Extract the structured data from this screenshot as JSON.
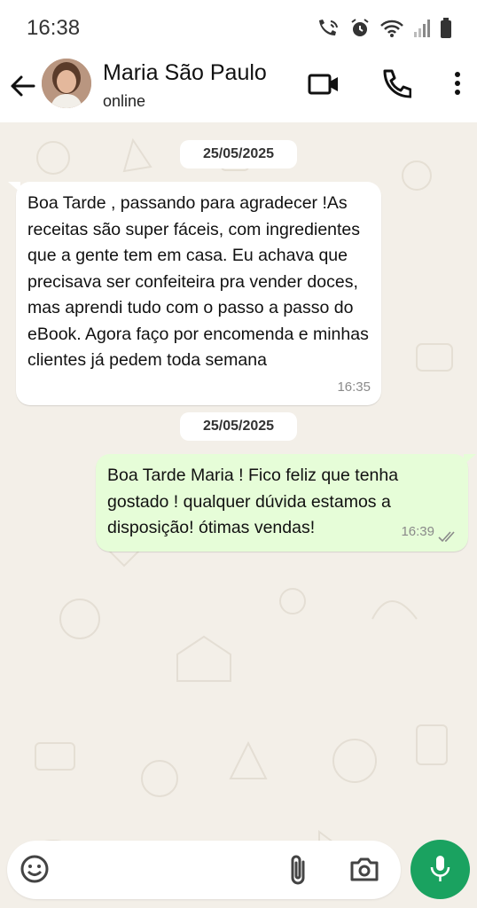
{
  "status_bar": {
    "time": "16:38"
  },
  "header": {
    "contact_name": "Maria São Paulo",
    "contact_status": "online"
  },
  "messages": [
    {
      "date": "25/05/2025",
      "direction": "incoming",
      "text": "Boa Tarde , passando para agradecer !As receitas são super fáceis, com ingredientes que a gente tem em casa. Eu achava que precisava ser confeiteira pra vender doces, mas aprendi tudo com o passo a passo do eBook. Agora faço por encomenda e minhas clientes já pedem toda semana",
      "time": "16:35"
    },
    {
      "date": "25/05/2025",
      "direction": "outgoing",
      "text": "Boa Tarde Maria ! Fico feliz que tenha gostado ! qualquer dúvida estamos a disposição! ótimas vendas!",
      "time": "16:39",
      "status": "read"
    }
  ],
  "icons": {
    "back": "arrow-left-icon",
    "video": "video-call-icon",
    "call": "phone-icon",
    "menu": "more-vert-icon",
    "emoji": "emoji-icon",
    "attach": "paperclip-icon",
    "camera": "camera-icon",
    "mic": "mic-icon"
  },
  "colors": {
    "chat_background": "#f3efe8",
    "incoming_bubble": "#ffffff",
    "outgoing_bubble": "#e6fdd8",
    "mic_button": "#1aa260",
    "read_ticks": "#8a8a8a"
  }
}
